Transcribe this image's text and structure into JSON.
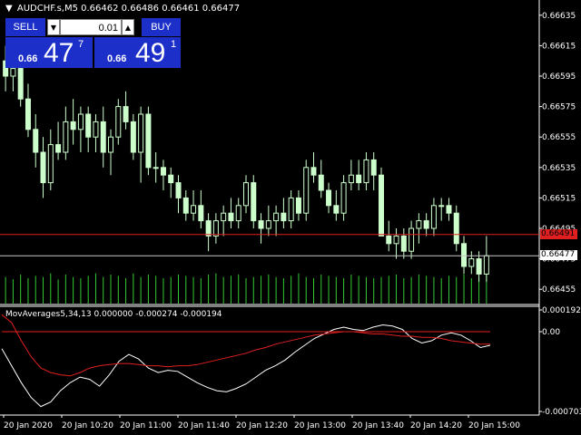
{
  "header": {
    "symbol_line": "AUDCHF.s,M5  0.66462 0.66486 0.66461 0.66477",
    "arrow": "▼"
  },
  "trade_panel": {
    "sell_label": "SELL",
    "buy_label": "BUY",
    "lot_value": "0.01",
    "lot_down_icon": "chevron-down-icon",
    "lot_up_icon": "chevron-up-icon",
    "sell_quote": {
      "prefix": "0.66",
      "big": "47",
      "sup": "7"
    },
    "buy_quote": {
      "prefix": "0.66",
      "big": "49",
      "sup": "1"
    }
  },
  "price_axis": [
    "0.66635",
    "0.66615",
    "0.66595",
    "0.66575",
    "0.66555",
    "0.66535",
    "0.66515",
    "0.66495",
    "0.66475",
    "0.66455"
  ],
  "price_tags": {
    "ask": "0.66491",
    "bid": "0.66477"
  },
  "indicator": {
    "title": "MovAverages5,34,13 0.000000 -0.000274 -0.000194",
    "axis": [
      "0.000192",
      "0.00",
      "-0.000703"
    ]
  },
  "time_axis": [
    "20 Jan 2020",
    "20 Jan 10:20",
    "20 Jan 11:00",
    "20 Jan 11:40",
    "20 Jan 12:20",
    "20 Jan 13:00",
    "20 Jan 13:40",
    "20 Jan 14:20",
    "20 Jan 15:00"
  ],
  "colors": {
    "background": "#000000",
    "bull_candle": "#ccffcc",
    "bear_candle": "#ccffcc",
    "volume": "#33cc33",
    "ask_line": "#e02020",
    "bid_line": "#c8c8c8",
    "signal_line": "#e02020",
    "main_line": "#ffffff",
    "panel_blue": "#1c2fc9"
  },
  "chart_data": [
    {
      "type": "candlestick",
      "symbol": "AUDCHF.s",
      "timeframe": "M5",
      "ylim": [
        0.66445,
        0.66645
      ],
      "candles": [
        [
          0.66605,
          0.66615,
          0.66585,
          0.66595
        ],
        [
          0.66595,
          0.6661,
          0.66585,
          0.666
        ],
        [
          0.666,
          0.66605,
          0.66575,
          0.6658
        ],
        [
          0.6658,
          0.6659,
          0.66555,
          0.6656
        ],
        [
          0.6656,
          0.6657,
          0.66535,
          0.66545
        ],
        [
          0.66545,
          0.66555,
          0.66515,
          0.66525
        ],
        [
          0.66525,
          0.6656,
          0.6652,
          0.6655
        ],
        [
          0.6655,
          0.66565,
          0.6654,
          0.66545
        ],
        [
          0.66545,
          0.66575,
          0.6654,
          0.66565
        ],
        [
          0.66565,
          0.6658,
          0.6655,
          0.6656
        ],
        [
          0.6656,
          0.66575,
          0.66545,
          0.6657
        ],
        [
          0.6657,
          0.66575,
          0.66545,
          0.66555
        ],
        [
          0.66555,
          0.6657,
          0.66545,
          0.66565
        ],
        [
          0.66565,
          0.66575,
          0.66535,
          0.66545
        ],
        [
          0.66545,
          0.6656,
          0.6653,
          0.66555
        ],
        [
          0.66555,
          0.6658,
          0.6655,
          0.66575
        ],
        [
          0.66575,
          0.66585,
          0.6656,
          0.66565
        ],
        [
          0.66565,
          0.6657,
          0.6654,
          0.66545
        ],
        [
          0.66545,
          0.66575,
          0.66525,
          0.6657
        ],
        [
          0.6657,
          0.66575,
          0.6653,
          0.66535
        ],
        [
          0.66535,
          0.66545,
          0.66525,
          0.66535
        ],
        [
          0.66535,
          0.6654,
          0.6652,
          0.6653
        ],
        [
          0.6653,
          0.66535,
          0.66515,
          0.66525
        ],
        [
          0.66525,
          0.6653,
          0.66505,
          0.66515
        ],
        [
          0.66515,
          0.6652,
          0.665,
          0.66505
        ],
        [
          0.66505,
          0.6652,
          0.665,
          0.6651
        ],
        [
          0.6651,
          0.6652,
          0.66495,
          0.665
        ],
        [
          0.665,
          0.66505,
          0.6648,
          0.6649
        ],
        [
          0.6649,
          0.66505,
          0.66485,
          0.665
        ],
        [
          0.665,
          0.6651,
          0.6649,
          0.66505
        ],
        [
          0.66505,
          0.66515,
          0.66495,
          0.665
        ],
        [
          0.665,
          0.66515,
          0.66495,
          0.6651
        ],
        [
          0.6651,
          0.6653,
          0.66505,
          0.66525
        ],
        [
          0.66525,
          0.6653,
          0.66495,
          0.665
        ],
        [
          0.665,
          0.66505,
          0.66485,
          0.66495
        ],
        [
          0.66495,
          0.6651,
          0.6649,
          0.665
        ],
        [
          0.665,
          0.6651,
          0.6649,
          0.66505
        ],
        [
          0.66505,
          0.66515,
          0.66495,
          0.665
        ],
        [
          0.665,
          0.6652,
          0.66495,
          0.66515
        ],
        [
          0.66515,
          0.6652,
          0.665,
          0.66505
        ],
        [
          0.66505,
          0.6654,
          0.665,
          0.66535
        ],
        [
          0.66535,
          0.66545,
          0.66525,
          0.6653
        ],
        [
          0.6653,
          0.6654,
          0.66515,
          0.6652
        ],
        [
          0.6652,
          0.66525,
          0.66505,
          0.6651
        ],
        [
          0.6651,
          0.6652,
          0.665,
          0.66505
        ],
        [
          0.66505,
          0.6653,
          0.665,
          0.66525
        ],
        [
          0.66525,
          0.6654,
          0.6652,
          0.6653
        ],
        [
          0.6653,
          0.6654,
          0.6652,
          0.66525
        ],
        [
          0.66525,
          0.66545,
          0.6652,
          0.6654
        ],
        [
          0.6654,
          0.66545,
          0.6652,
          0.6653
        ],
        [
          0.6653,
          0.66535,
          0.66495,
          0.6649
        ],
        [
          0.6649,
          0.665,
          0.6648,
          0.66485
        ],
        [
          0.66485,
          0.66495,
          0.66475,
          0.6649
        ],
        [
          0.6649,
          0.66495,
          0.66475,
          0.6648
        ],
        [
          0.6648,
          0.665,
          0.66475,
          0.66495
        ],
        [
          0.66495,
          0.66505,
          0.66485,
          0.665
        ],
        [
          0.665,
          0.66505,
          0.6649,
          0.66495
        ],
        [
          0.66495,
          0.66515,
          0.6649,
          0.6651
        ],
        [
          0.6651,
          0.66515,
          0.665,
          0.6651
        ],
        [
          0.6651,
          0.66515,
          0.665,
          0.66505
        ],
        [
          0.66505,
          0.6651,
          0.6648,
          0.66485
        ],
        [
          0.66485,
          0.6649,
          0.66465,
          0.6647
        ],
        [
          0.6647,
          0.6648,
          0.66465,
          0.66475
        ],
        [
          0.66475,
          0.6648,
          0.6646,
          0.66465
        ],
        [
          0.66465,
          0.6649,
          0.6646,
          0.66477
        ]
      ],
      "volumes": [
        22,
        20,
        24,
        21,
        23,
        22,
        25,
        20,
        24,
        22,
        21,
        23,
        25,
        22,
        24,
        23,
        21,
        25,
        22,
        24,
        23,
        21,
        22,
        24,
        23,
        22,
        21,
        24,
        25,
        22,
        23,
        24,
        21,
        22,
        23,
        24,
        22,
        21,
        23,
        25,
        22,
        21,
        24,
        23,
        22,
        21,
        24,
        23,
        22,
        21,
        22,
        23,
        24,
        21,
        22,
        24,
        23,
        22,
        21,
        23,
        22,
        24,
        21,
        22,
        36
      ]
    },
    {
      "type": "line",
      "title": "MovAverages5,34,13 0.000000 -0.000274 -0.000194",
      "ylim": [
        -0.000703,
        0.000192
      ],
      "series": [
        {
          "values": [
            -0.00015,
            -0.0003,
            -0.00045,
            -0.00058,
            -0.00066,
            -0.00062,
            -0.00052,
            -0.00045,
            -0.0004,
            -0.00042,
            -0.00048,
            -0.00038,
            -0.00026,
            -0.0002,
            -0.00024,
            -0.00032,
            -0.00036,
            -0.00034,
            -0.00035,
            -0.0004,
            -0.00045,
            -0.00049,
            -0.00052,
            -0.00053,
            -0.0005,
            -0.00046,
            -0.0004,
            -0.00034,
            -0.0003,
            -0.00025,
            -0.00018,
            -0.00012,
            -6e-05,
            -2e-05,
            2e-05,
            4e-05,
            2e-05,
            1e-05,
            4e-05,
            6e-05,
            5e-05,
            2e-05,
            -6e-05,
            -0.0001,
            -8e-05,
            -3e-05,
            -1e-05,
            -3e-05,
            -8e-05,
            -0.00014,
            -0.00012
          ]
        },
        {
          "values": [
            0.00015,
            8e-05,
            -8e-05,
            -0.00022,
            -0.00032,
            -0.00036,
            -0.00038,
            -0.00039,
            -0.00036,
            -0.00032,
            -0.0003,
            -0.00029,
            -0.00028,
            -0.00028,
            -0.00029,
            -0.0003,
            -0.0003,
            -0.00031,
            -0.0003,
            -0.0003,
            -0.00029,
            -0.00027,
            -0.00025,
            -0.00023,
            -0.00021,
            -0.00019,
            -0.00016,
            -0.00014,
            -0.00011,
            -9e-05,
            -7e-05,
            -5e-05,
            -3e-05,
            -2e-05,
            -1e-05,
            0.0,
            0.0,
            -1e-05,
            -2e-05,
            -2e-05,
            -3e-05,
            -4e-05,
            -4e-05,
            -5e-05,
            -5e-05,
            -6e-05,
            -8e-05,
            -9e-05,
            -0.0001,
            -0.00011,
            -0.00011
          ]
        },
        {
          "values": [
            0.0,
            0.0
          ]
        }
      ]
    }
  ]
}
